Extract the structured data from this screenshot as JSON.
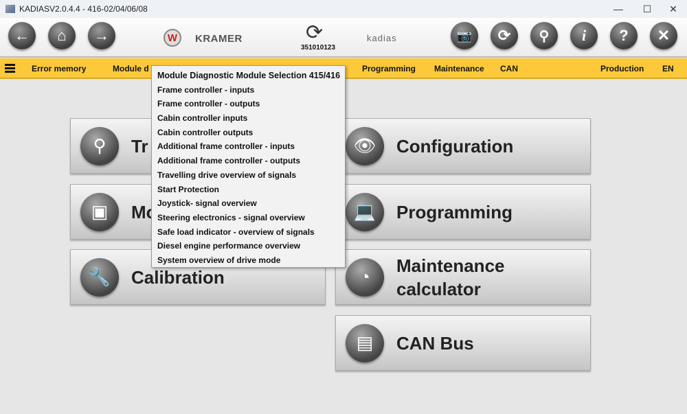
{
  "window": {
    "title": "KADIASV2.0.4.4 - 416-02/04/06/08",
    "minimize": "—",
    "maximize": "☐",
    "close": "✕"
  },
  "toolbar": {
    "brand": "KRAMER",
    "brand_logo": "W",
    "serial": "351010123",
    "product_logo": "kadias"
  },
  "menubar": {
    "items": [
      "Error memory",
      "Module d",
      "Programming",
      "Maintenance",
      "CAN",
      "Production",
      "EN"
    ]
  },
  "tiles": [
    {
      "label": "Tr",
      "icon": "magnifier-icon"
    },
    {
      "label": "Mo",
      "icon": "module-icon"
    },
    {
      "label": "Calibration",
      "icon": "wrench-icon"
    },
    {
      "label": "Configuration",
      "icon": "eye-icon"
    },
    {
      "label": "Programming",
      "icon": "laptop-icon"
    },
    {
      "label": "Maintenance calculator",
      "icon": "clock-wrench-icon"
    },
    {
      "label": "CAN Bus",
      "icon": "document-icon"
    }
  ],
  "dropdown": {
    "items": [
      "Module Diagnostic Module Selection 415/416",
      "Frame controller -  inputs",
      "Frame controller -  outputs",
      "Cabin controller inputs",
      "Cabin controller outputs",
      "Additional frame controller -  inputs",
      "Additional frame controller -  outputs",
      "Travelling drive overview of signals",
      "Start Protection",
      "Joystick- signal overview",
      "Steering electronics -  signal overview",
      "Safe load indicator - overview of signals",
      "Diesel engine performance overview",
      "System overview of drive mode"
    ]
  }
}
